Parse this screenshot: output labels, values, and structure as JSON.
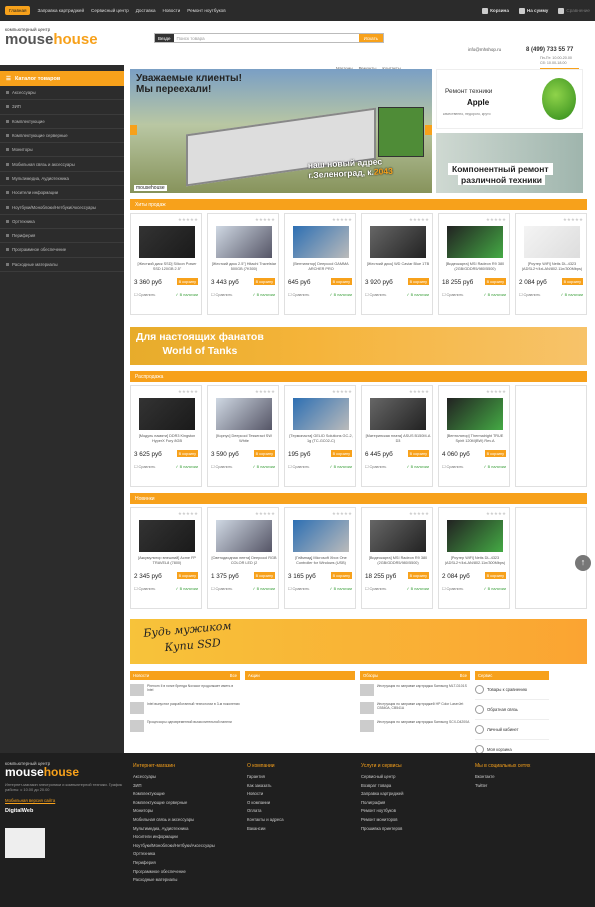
{
  "topbar": {
    "nav": [
      "Главная",
      "Заправка картриджей",
      "Сервисный центр",
      "Доставка",
      "Новости",
      "Ремонт ноутбуков"
    ],
    "cart": "Корзина",
    "sum": "На сумму",
    "compare": "Сравнение"
  },
  "header": {
    "logo_sub": "компьютерный центр",
    "logo_a": "mouse",
    "logo_b": "house",
    "search_cat": "Везде",
    "search_placeholder": "Поиск товара",
    "search_btn": "Искать",
    "links": [
      "Магазин",
      "Ремонты",
      "Контакты"
    ],
    "email": "info@mhshop.ru",
    "phone": "8 (499) 733 55 77",
    "hours1": "Пн-Пт: 10.00-20.00",
    "hours2": "Сб: 10.00-18.00",
    "login": "Вход | Регистрация",
    "cart_btn": "Оформить заказ"
  },
  "sidebar": {
    "title": "Каталог товаров",
    "items": [
      "Аксессуары",
      "ЗИП",
      "Комплектующие",
      "Комплектующие серверные",
      "Мониторы",
      "Мобильная связь и аксессуары",
      "Мультимедиа, Аудиотехника",
      "Носители информации",
      "Ноутбуки/Моноблоки/Нетбуки/Аксессуары",
      "Оргтехника",
      "Периферия",
      "Программное обеспечение",
      "Расходные материалы"
    ]
  },
  "banners": {
    "main_title": "Уважаемые клиенты!\nМы переехали!",
    "main_addr1": "наш новый адрес",
    "main_addr2": "г.Зеленоград, к.",
    "main_addr3": "2043",
    "main_logo": "mousehouse",
    "apple_1": "Ремонт техники",
    "apple_2": "Apple",
    "apple_3": "качественно, недорого, круто",
    "repair_1": "Компонентный ремонт",
    "repair_2": "различной техники"
  },
  "sections": [
    {
      "title": "Хиты продаж",
      "items": [
        {
          "name": "[Жесткий диск SSD] Silicon Power SSD 120GB 2.5\"",
          "price": "3 360 руб"
        },
        {
          "name": "[Жесткий диск 2.5\"] Hitachi Travelstar 500GB (7K500)",
          "price": "3 443 руб"
        },
        {
          "name": "[Вентилятор] Deepcool GAMMA ARCHER PRO",
          "price": "645 руб"
        },
        {
          "name": "[Жесткий диск] WD Caviar Blue 1TB",
          "price": "3 920 руб"
        },
        {
          "name": "[Видеокарта] MSI Radeon R9 380 (2GB/GDDR5/980/5500)",
          "price": "18 255 руб"
        },
        {
          "name": "[Роутер WiFi] Netis DL-4323 (ADSL2+/4xLAN/802.11n/300Mbps)",
          "price": "2 084 руб"
        }
      ]
    },
    {
      "title": "Распродажа",
      "items": [
        {
          "name": "[Модуль памяти] DDR3 Kingston HyperX Fury 8GB",
          "price": "3 625 руб"
        },
        {
          "name": "[Корпус] Deepcool Tesseract SW White",
          "price": "3 590 руб"
        },
        {
          "name": "[Термопаста] GELID Solutions GC-2, 1g (TC-GC02-C)",
          "price": "195 руб"
        },
        {
          "name": "[Материнская плата] ASUS B150M-A D3",
          "price": "6 445 руб"
        },
        {
          "name": "[Вентилятор] Thermalright TRUE Spirit 120M(BW) Rev.A",
          "price": "4 060 руб"
        },
        {
          "name": "",
          "price": ""
        }
      ]
    },
    {
      "title": "Новинки",
      "items": [
        {
          "name": "[Аккумулятор внешний] Acme FP TRAVEL8 (7800)",
          "price": "2 345 руб"
        },
        {
          "name": "[Светодиодная лента] Deepcool RGB COLOR LED (2",
          "price": "1 375 руб"
        },
        {
          "name": "[Геймпад] Microsoft Xbox One Controller for Windows (USB)",
          "price": "3 165 руб"
        },
        {
          "name": "[Видеокарта] MSI Radeon R9 380 (2GB/GDDR5/980/5500)",
          "price": "18 255 руб"
        },
        {
          "name": "[Роутер WiFi] Netis DL-4323 (ADSL2+/4xLAN/802.11n/300Mbps)",
          "price": "2 084 руб"
        },
        {
          "name": "",
          "price": ""
        }
      ]
    }
  ],
  "product_labels": {
    "cart": "В корзину",
    "compare": "Сравнить",
    "stock": "В наличии"
  },
  "promo": {
    "wot1": "Для настоящих фанатов",
    "wot2": "World of Tanks",
    "ssd1": "Будь мужиком",
    "ssd2": "Купи SSD"
  },
  "news": {
    "news_title": "Новости",
    "news_all": "Все",
    "news_items": [
      "Phenom II в гонке бренда Novacor продолжает иметь в Intel",
      "Intel выпустил разработанный технологии в 3-м поколении",
      "Процессоры одновременной вычислительной панели"
    ],
    "actions_title": "Акции",
    "reviews_title": "Обзоры",
    "reviews_items": [
      "Инструкция по заправке картриджа Samsung MLT-D101S",
      "Инструкция по заправке картриджей HP Color LaserJet CB540A, CB541A",
      "Инструкция по заправке картриджа Samsung SCX-D4200A"
    ],
    "services_title": "Сервис",
    "services": [
      "Товары к сравнению",
      "Обратная связь",
      "Личный кабинет",
      "Моя корзина"
    ]
  },
  "footer": {
    "logo_sub": "компьютерный центр",
    "desc": "Интернет-магазин электроники и компьютерной техники. График работы: с 10.00 до 20.00",
    "mobile": "Мобильная версия сайта",
    "digital": "DigitalWeb",
    "col1_title": "Интернет-магазин",
    "col1": [
      "Аксессуары",
      "ЗИП",
      "Комплектующие",
      "Комплектующие серверные",
      "Мониторы",
      "Мобильная связь и аксессуары",
      "Мультимедиа, Аудиотехника",
      "Носители информации",
      "Ноутбуки/Моноблоки/Нетбуки/Аксессуары",
      "Оргтехника",
      "Периферия",
      "Программное обеспечение",
      "Расходные материалы"
    ],
    "col2_title": "О компании",
    "col2": [
      "Гарантия",
      "Как заказать",
      "Новости",
      "О компании",
      "Оплата",
      "Контакты и адреса",
      "Вакансии"
    ],
    "col3_title": "Услуги и сервисы",
    "col3": [
      "Сервисный центр",
      "Возврат товара",
      "Заправка картриджей",
      "Полиграфия",
      "Ремонт ноутбуков",
      "Ремонт мониторов",
      "Прошивка принтеров"
    ],
    "col4_title": "Мы в социальных сетях",
    "col4": [
      "Вконтакте",
      "Twitter"
    ]
  }
}
